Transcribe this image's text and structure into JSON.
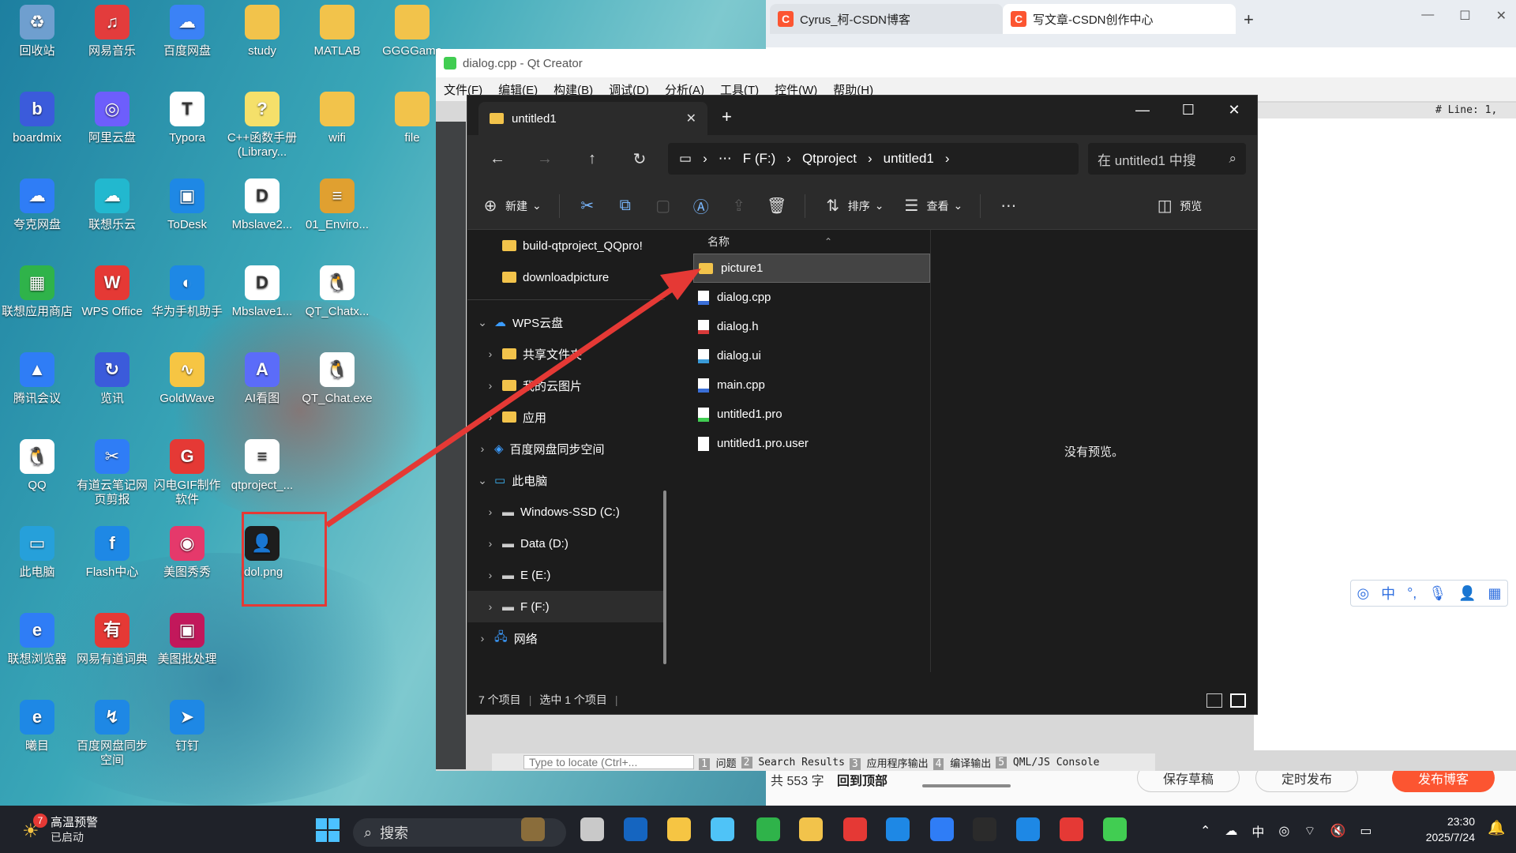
{
  "desktop": {
    "icons": [
      {
        "label": "回收站",
        "color": "#6f9fcf",
        "glyph": "♻",
        "icon": "recycle-bin-icon"
      },
      {
        "label": "网易音乐",
        "color": "#e33c3c",
        "glyph": "♫",
        "icon": "netease-music-icon"
      },
      {
        "label": "百度网盘",
        "color": "#3b82f6",
        "glyph": "☁",
        "icon": "baidu-netdisk-icon"
      },
      {
        "label": "study",
        "color": "#f2c34b",
        "glyph": "",
        "icon": "folder-icon"
      },
      {
        "label": "MATLAB",
        "color": "#f2c34b",
        "glyph": "",
        "icon": "folder-icon"
      },
      {
        "label": "GGGGame",
        "color": "#f2c34b",
        "glyph": "",
        "icon": "folder-icon"
      },
      {
        "label": "boardmix",
        "color": "#3b5bdb",
        "glyph": "b",
        "icon": "boardmix-icon"
      },
      {
        "label": "阿里云盘",
        "color": "#6d5efc",
        "glyph": "◎",
        "icon": "aliyun-drive-icon"
      },
      {
        "label": "Typora",
        "color": "#ffffff",
        "glyph": "T",
        "icon": "typora-icon"
      },
      {
        "label": "C++函数手册(Library...",
        "color": "#f5e06a",
        "glyph": "?",
        "icon": "help-doc-icon"
      },
      {
        "label": "wifi",
        "color": "#f2c34b",
        "glyph": "",
        "icon": "folder-icon"
      },
      {
        "label": "file",
        "color": "#f2c34b",
        "glyph": "",
        "icon": "folder-icon"
      },
      {
        "label": "夸克网盘",
        "color": "#2f7df6",
        "glyph": "☁",
        "icon": "quark-drive-icon"
      },
      {
        "label": "联想乐云",
        "color": "#22b8cf",
        "glyph": "☁",
        "icon": "lenovo-cloud-icon"
      },
      {
        "label": "ToDesk",
        "color": "#1e88e5",
        "glyph": "▣",
        "icon": "todesk-icon"
      },
      {
        "label": "Mbslave2...",
        "color": "#ffffff",
        "glyph": "D",
        "icon": "doc-file-icon"
      },
      {
        "label": "01_Enviro...",
        "color": "#e0a030",
        "glyph": "≡",
        "icon": "archive-icon"
      },
      {
        "label": "联想应用商店",
        "color": "#2fb34a",
        "glyph": "▦",
        "icon": "lenovo-store-icon"
      },
      {
        "label": "WPS Office",
        "color": "#e53935",
        "glyph": "W",
        "icon": "wps-office-icon"
      },
      {
        "label": "华为手机助手",
        "color": "#1e88e5",
        "glyph": "◐",
        "icon": "huawei-assistant-icon"
      },
      {
        "label": "Mbslave1...",
        "color": "#ffffff",
        "glyph": "D",
        "icon": "doc-file-icon"
      },
      {
        "label": "QT_Chatx...",
        "color": "#ffffff",
        "glyph": "🐧",
        "icon": "qq-penguin-icon"
      },
      {
        "label": "腾讯会议",
        "color": "#2f7df6",
        "glyph": "▲",
        "icon": "tencent-meeting-icon"
      },
      {
        "label": "览讯",
        "color": "#3b5bdb",
        "glyph": "↻",
        "icon": "lanxun-icon"
      },
      {
        "label": "GoldWave",
        "color": "#f6c543",
        "glyph": "∿",
        "icon": "goldwave-icon"
      },
      {
        "label": "AI看图",
        "color": "#5b6cf9",
        "glyph": "A",
        "icon": "ai-viewer-icon"
      },
      {
        "label": "QT_Chat.exe",
        "color": "#ffffff",
        "glyph": "🐧",
        "icon": "qq-penguin-icon"
      },
      {
        "label": "QQ",
        "color": "#ffffff",
        "glyph": "🐧",
        "icon": "qq-icon"
      },
      {
        "label": "有道云笔记网页剪报",
        "color": "#2f7df6",
        "glyph": "✂",
        "icon": "youdao-clip-icon"
      },
      {
        "label": "闪电GIF制作软件",
        "color": "#e53935",
        "glyph": "G",
        "icon": "gif-maker-icon"
      },
      {
        "label": "qtproject_...",
        "color": "#ffffff",
        "glyph": "≡",
        "icon": "text-file-icon"
      },
      {
        "label": "此电脑",
        "color": "#26a0da",
        "glyph": "▭",
        "icon": "this-pc-icon"
      },
      {
        "label": "Flash中心",
        "color": "#1e88e5",
        "glyph": "f",
        "icon": "flash-center-icon"
      },
      {
        "label": "美图秀秀",
        "color": "#e5396b",
        "glyph": "◉",
        "icon": "meitu-icon"
      },
      {
        "label": "idol.png",
        "color": "#1d1d1d",
        "glyph": "👤",
        "icon": "png-thumbnail-icon"
      },
      {
        "label": "联想浏览器",
        "color": "#2f7df6",
        "glyph": "e",
        "icon": "lenovo-browser-icon"
      },
      {
        "label": "网易有道词典",
        "color": "#e53935",
        "glyph": "有",
        "icon": "youdao-dict-icon"
      },
      {
        "label": "美图批处理",
        "color": "#c2185b",
        "glyph": "▣",
        "icon": "meitu-batch-icon"
      },
      {
        "label": "曦目",
        "color": "#1e88e5",
        "glyph": "e",
        "icon": "ximu-icon"
      },
      {
        "label": "百度网盘同步空间",
        "color": "#1e88e5",
        "glyph": "↯",
        "icon": "baidu-sync-icon"
      },
      {
        "label": "钉钉",
        "color": "#1e88e5",
        "glyph": "➤",
        "icon": "dingtalk-icon"
      }
    ]
  },
  "browser": {
    "tabs": [
      "Cyrus_柯-CSDN博客",
      "写文章-CSDN创作中心"
    ],
    "footer": {
      "word_count": "共 553 字",
      "top_link": "回到顶部",
      "save_draft": "保存草稿",
      "schedule": "定时发布",
      "publish": "发布博客"
    }
  },
  "qt": {
    "title": "dialog.cpp - Qt Creator",
    "menu": [
      "文件(F)",
      "编辑(E)",
      "构建(B)",
      "调试(D)",
      "分析(A)",
      "工具(T)",
      "控件(W)",
      "帮助(H)"
    ],
    "line_info": "# Line: 1,",
    "locator": "Type to locate (Ctrl+...",
    "panes": [
      {
        "num": "1",
        "label": "问题"
      },
      {
        "num": "2",
        "label": "Search Results"
      },
      {
        "num": "3",
        "label": "应用程序输出"
      },
      {
        "num": "4",
        "label": "编译输出"
      },
      {
        "num": "5",
        "label": "QML/JS Console"
      }
    ]
  },
  "explorer": {
    "tab_title": "untitled1",
    "path": [
      "F (F:)",
      "Qtproject",
      "untitled1"
    ],
    "search_placeholder": "在 untitled1 中搜",
    "toolbar": {
      "new": "新建",
      "sort": "排序",
      "view": "查看",
      "preview": "预览"
    },
    "nav_items": [
      {
        "label": "build-qtproject_QQpro!",
        "indent": 1,
        "chev": "",
        "type": "folder"
      },
      {
        "label": "downloadpicture",
        "indent": 1,
        "chev": "",
        "type": "folder"
      },
      {
        "label": "WPS云盘",
        "indent": 0,
        "chev": "⌄",
        "type": "cloud"
      },
      {
        "label": "共享文件夹",
        "indent": 1,
        "chev": "›",
        "type": "folder"
      },
      {
        "label": "我的云图片",
        "indent": 1,
        "chev": "›",
        "type": "folder"
      },
      {
        "label": "应用",
        "indent": 1,
        "chev": "›",
        "type": "folder"
      },
      {
        "label": "百度网盘同步空间",
        "indent": 0,
        "chev": "›",
        "type": "baidu"
      },
      {
        "label": "此电脑",
        "indent": 0,
        "chev": "⌄",
        "type": "pc"
      },
      {
        "label": "Windows-SSD (C:)",
        "indent": 1,
        "chev": "›",
        "type": "drive"
      },
      {
        "label": "Data (D:)",
        "indent": 1,
        "chev": "›",
        "type": "drive"
      },
      {
        "label": "E (E:)",
        "indent": 1,
        "chev": "›",
        "type": "drive"
      },
      {
        "label": "F (F:)",
        "indent": 1,
        "chev": "›",
        "type": "drive"
      },
      {
        "label": "网络",
        "indent": 0,
        "chev": "›",
        "type": "network"
      }
    ],
    "column_header": "名称",
    "files": [
      {
        "name": "picture1",
        "type": "folder"
      },
      {
        "name": "dialog.cpp",
        "type": "cpp"
      },
      {
        "name": "dialog.h",
        "type": "h"
      },
      {
        "name": "dialog.ui",
        "type": "ui"
      },
      {
        "name": "main.cpp",
        "type": "cpp"
      },
      {
        "name": "untitled1.pro",
        "type": "pro"
      },
      {
        "name": "untitled1.pro.user",
        "type": "file"
      }
    ],
    "preview_text": "没有预览。",
    "status": {
      "count": "7 个项目",
      "selected": "选中 1 个项目"
    }
  },
  "taskbar": {
    "weather_badge": "7",
    "weather_title": "高温预警",
    "weather_sub": "已启动",
    "search_placeholder": "搜索",
    "ime": "中",
    "time": "23:30",
    "date": "2025/7/24"
  },
  "colors": {
    "accent": "#2f7df6",
    "csdn": "#fc5531",
    "annotation": "#e53935"
  }
}
